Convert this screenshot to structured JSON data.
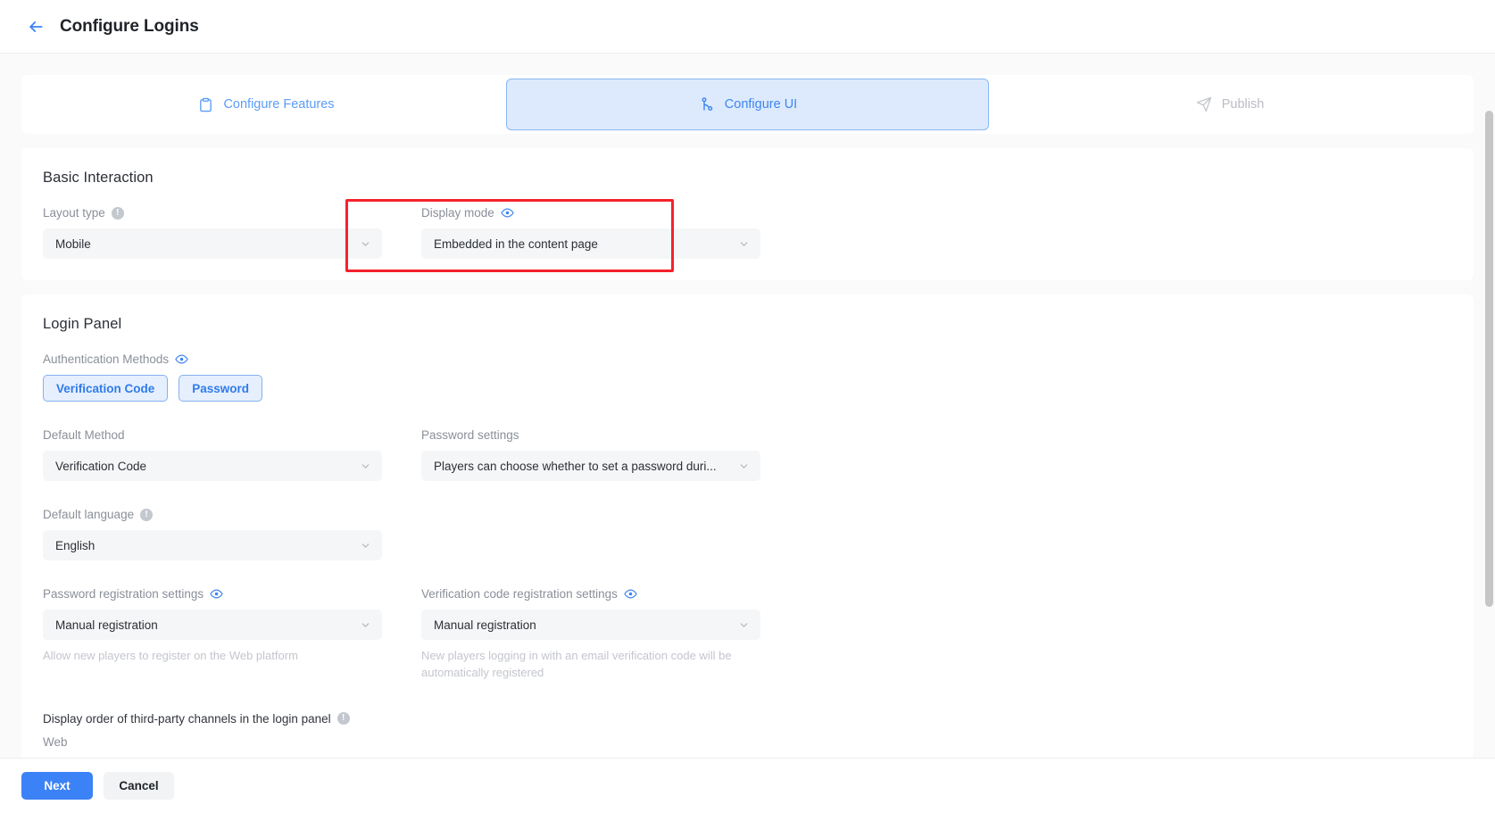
{
  "header": {
    "back_icon": "arrow-left-icon",
    "title": "Configure Logins"
  },
  "steps": [
    {
      "label": "Configure Features",
      "icon": "clipboard-icon",
      "state": "inactive"
    },
    {
      "label": "Configure UI",
      "icon": "node-branch-icon",
      "state": "active"
    },
    {
      "label": "Publish",
      "icon": "send-icon",
      "state": "disabled"
    }
  ],
  "basic_interaction": {
    "title": "Basic Interaction",
    "layout_type": {
      "label": "Layout type",
      "info_icon": "info-icon",
      "value": "Mobile"
    },
    "display_mode": {
      "label": "Display mode",
      "eye_icon": "eye-icon",
      "value": "Embedded in the content page"
    }
  },
  "login_panel": {
    "title": "Login Panel",
    "auth_methods": {
      "label": "Authentication Methods",
      "eye_icon": "eye-icon",
      "chips": [
        "Verification Code",
        "Password"
      ]
    },
    "default_method": {
      "label": "Default Method",
      "value": "Verification Code"
    },
    "password_settings": {
      "label": "Password settings",
      "value": "Players can choose whether to set a password duri..."
    },
    "default_language": {
      "label": "Default language",
      "info_icon": "info-icon",
      "value": "English"
    },
    "password_registration": {
      "label": "Password registration settings",
      "eye_icon": "eye-icon",
      "value": "Manual registration",
      "helper": "Allow new players to register on the Web platform"
    },
    "verification_registration": {
      "label": "Verification code registration settings",
      "eye_icon": "eye-icon",
      "value": "Manual registration",
      "helper": "New players logging in with an email verification code will be automatically registered"
    },
    "third_party_order": {
      "label": "Display order of third-party channels in the login panel",
      "info_icon": "info-icon",
      "platform": "Web"
    }
  },
  "footer": {
    "next_label": "Next",
    "cancel_label": "Cancel"
  },
  "annotations": {
    "highlight_color": "#f5222d",
    "highlight_target": "display-mode-field"
  },
  "colors": {
    "accent": "#3b82f6",
    "active_tab_bg": "#ddeafd",
    "field_bg": "#f5f6f7",
    "page_bg": "#fafafa"
  }
}
